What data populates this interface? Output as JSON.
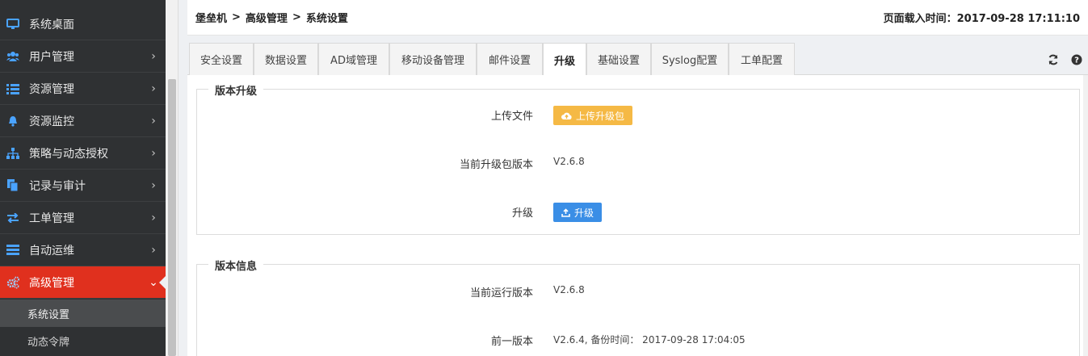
{
  "sidebar": {
    "items": [
      {
        "label": "系统桌面",
        "icon": "desktop-icon"
      },
      {
        "label": "用户管理",
        "icon": "users-icon"
      },
      {
        "label": "资源管理",
        "icon": "list-icon"
      },
      {
        "label": "资源监控",
        "icon": "bell-icon"
      },
      {
        "label": "策略与动态授权",
        "icon": "sitemap-icon"
      },
      {
        "label": "记录与审计",
        "icon": "documents-icon"
      },
      {
        "label": "工单管理",
        "icon": "exchange-icon"
      },
      {
        "label": "自动运维",
        "icon": "server-icon"
      },
      {
        "label": "高级管理",
        "icon": "cogs-icon",
        "active": true
      }
    ],
    "subitems": [
      {
        "label": "系统设置",
        "current": true
      },
      {
        "label": "动态令牌"
      }
    ]
  },
  "header": {
    "breadcrumb": [
      "堡垒机",
      "高级管理",
      "系统设置"
    ],
    "breadcrumb_sep": ">",
    "load_time_label": "页面载入时间：",
    "load_time": "2017-09-28 17:11:10"
  },
  "tabs": [
    {
      "label": "安全设置"
    },
    {
      "label": "数据设置"
    },
    {
      "label": "AD域管理"
    },
    {
      "label": "移动设备管理"
    },
    {
      "label": "邮件设置"
    },
    {
      "label": "升级",
      "active": true
    },
    {
      "label": "基础设置"
    },
    {
      "label": "Syslog配置"
    },
    {
      "label": "工单配置"
    }
  ],
  "toolbar": {
    "refresh_icon": "refresh-icon",
    "help_icon": "help-icon"
  },
  "upgrade_section": {
    "title": "版本升级",
    "upload_label": "上传文件",
    "upload_button": "上传升级包",
    "current_pkg_label": "当前升级包版本",
    "current_pkg_value": "V2.6.8",
    "upgrade_label": "升级",
    "upgrade_button": "升级"
  },
  "info_section": {
    "title": "版本信息",
    "running_label": "当前运行版本",
    "running_value": "V2.6.8",
    "previous_label": "前一版本",
    "previous_value": "V2.6.4, 备份时间： 2017-09-28 17:04:05"
  },
  "colors": {
    "sidebar_bg": "#2f3133",
    "active_nav": "#e0301e",
    "upload_button": "#f5b945",
    "upgrade_button": "#3a8ee6"
  }
}
